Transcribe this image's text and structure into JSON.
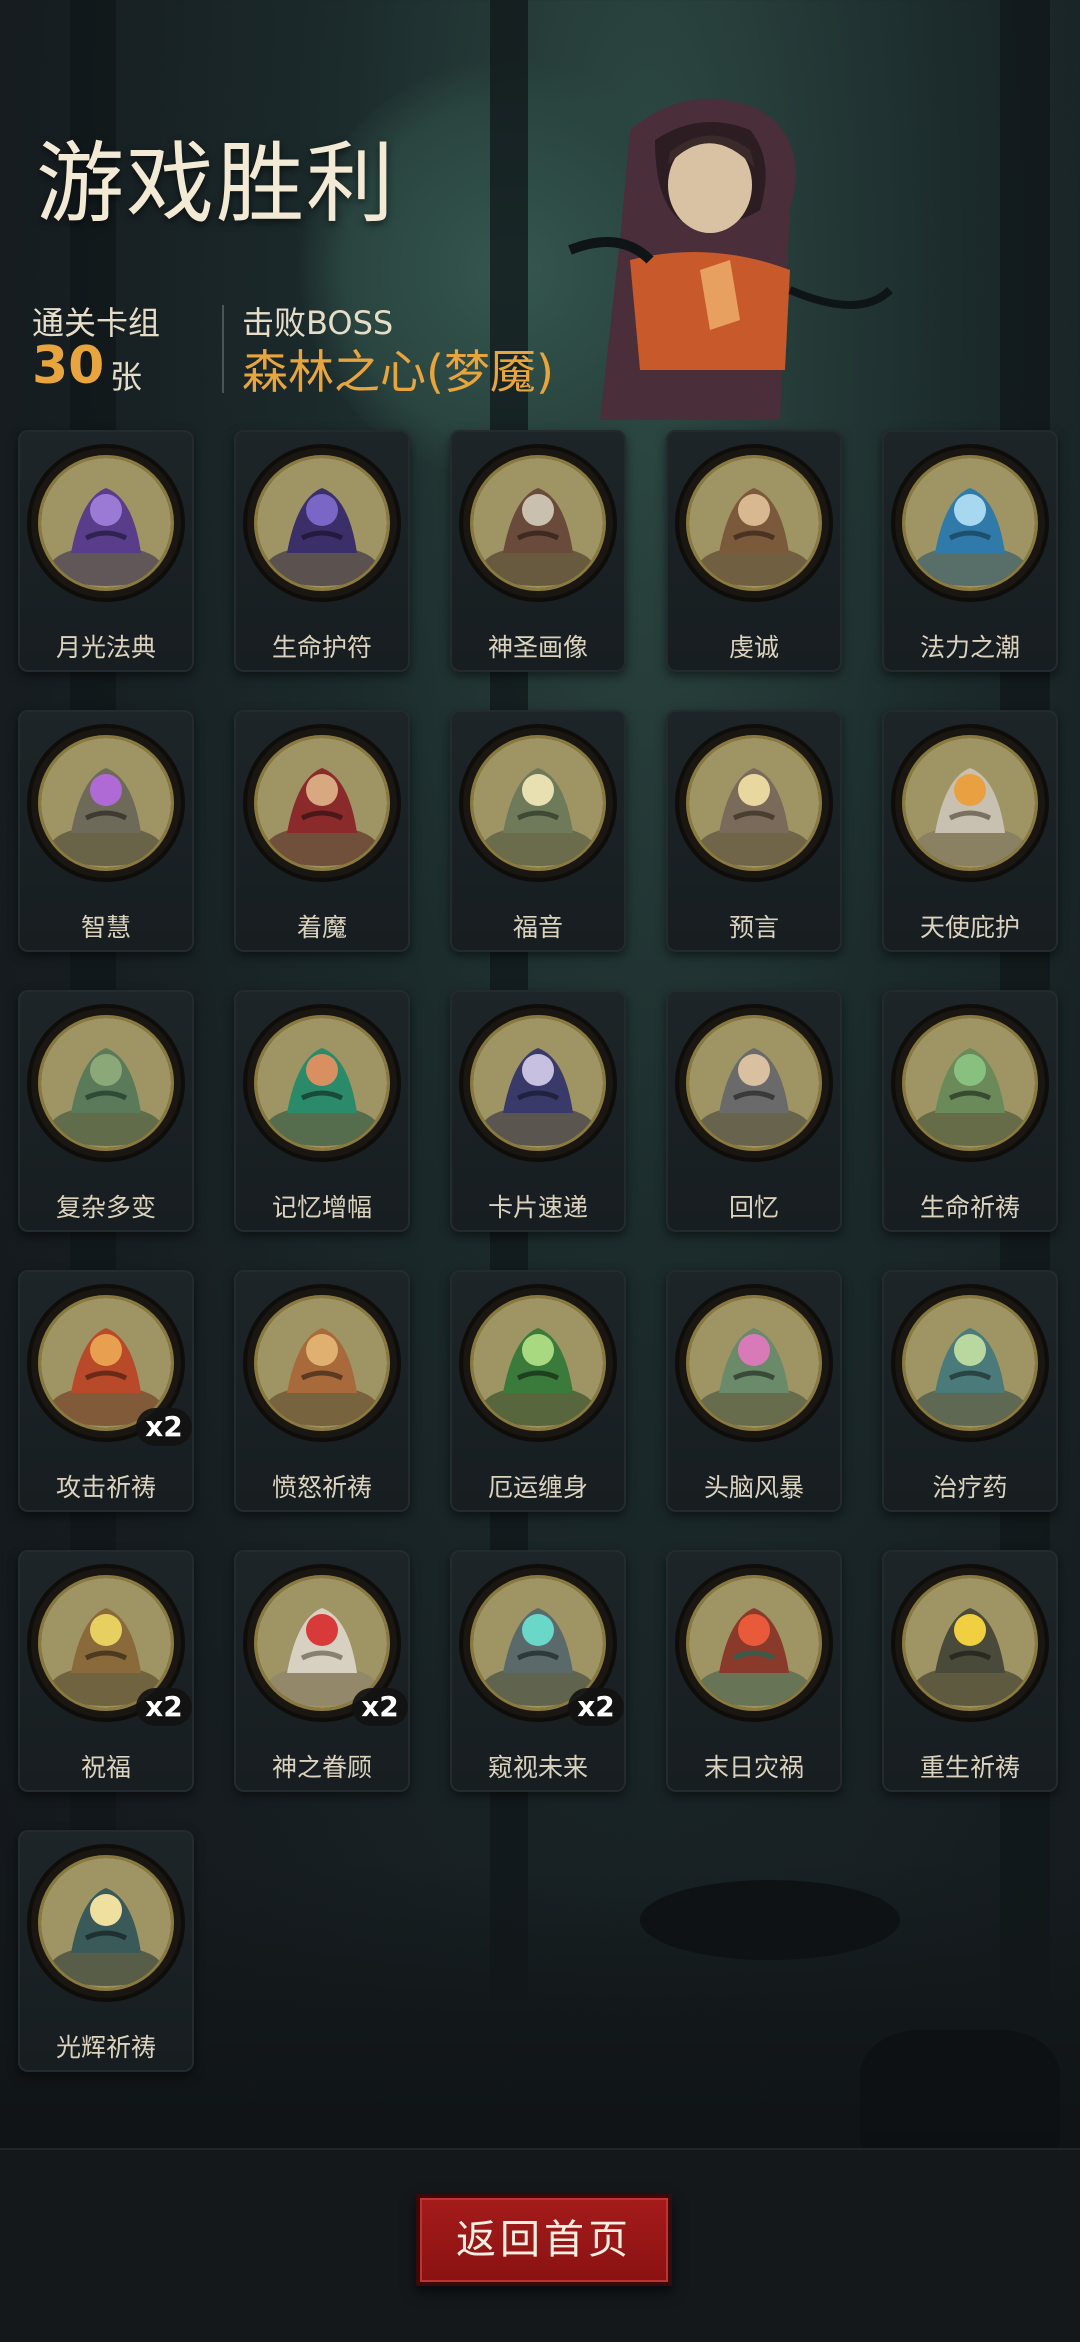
{
  "title": "游戏胜利",
  "stats": {
    "deck_label": "通关卡组",
    "deck_count": "30",
    "deck_unit": "张",
    "boss_label": "击败BOSS",
    "boss_name": "森林之心(梦魇)"
  },
  "colors": {
    "accent_gold": "#e8a53d",
    "button_red": "#a51b1b",
    "medallion_bg": "#9e9464"
  },
  "cards": [
    {
      "name": "月光法典",
      "icon": "tome-icon",
      "multiplier": ""
    },
    {
      "name": "生命护符",
      "icon": "bat-amulet-icon",
      "multiplier": ""
    },
    {
      "name": "神圣画像",
      "icon": "portrait-icon",
      "multiplier": ""
    },
    {
      "name": "虔诚",
      "icon": "praying-figure-icon",
      "multiplier": ""
    },
    {
      "name": "法力之潮",
      "icon": "wave-icon",
      "multiplier": ""
    },
    {
      "name": "智慧",
      "icon": "sage-icon",
      "multiplier": ""
    },
    {
      "name": "着魔",
      "icon": "possessed-icon",
      "multiplier": ""
    },
    {
      "name": "福音",
      "icon": "cross-icon",
      "multiplier": ""
    },
    {
      "name": "预言",
      "icon": "prophet-icon",
      "multiplier": ""
    },
    {
      "name": "天使庇护",
      "icon": "winged-crown-icon",
      "multiplier": ""
    },
    {
      "name": "复杂多变",
      "icon": "tangle-icon",
      "multiplier": ""
    },
    {
      "name": "记忆增幅",
      "icon": "brain-icon",
      "multiplier": ""
    },
    {
      "name": "卡片速递",
      "icon": "flying-card-icon",
      "multiplier": ""
    },
    {
      "name": "回忆",
      "icon": "old-man-icon",
      "multiplier": ""
    },
    {
      "name": "生命祈祷",
      "icon": "sprout-icon",
      "multiplier": ""
    },
    {
      "name": "攻击祈祷",
      "icon": "fist-icon",
      "multiplier": "x2"
    },
    {
      "name": "愤怒祈祷",
      "icon": "beast-icon",
      "multiplier": ""
    },
    {
      "name": "厄运缠身",
      "icon": "skull-icon",
      "multiplier": ""
    },
    {
      "name": "头脑风暴",
      "icon": "zombie-brain-icon",
      "multiplier": ""
    },
    {
      "name": "治疗药",
      "icon": "zombie-potion-icon",
      "multiplier": ""
    },
    {
      "name": "祝福",
      "icon": "knight-icon",
      "multiplier": "x2"
    },
    {
      "name": "神之眷顾",
      "icon": "angel-heart-icon",
      "multiplier": "x2"
    },
    {
      "name": "窥视未来",
      "icon": "spiral-mirror-icon",
      "multiplier": "x2"
    },
    {
      "name": "末日灾祸",
      "icon": "fire-field-icon",
      "multiplier": ""
    },
    {
      "name": "重生祈祷",
      "icon": "lightning-icon",
      "multiplier": ""
    },
    {
      "name": "光辉祈祷",
      "icon": "hooded-light-icon",
      "multiplier": ""
    }
  ],
  "return_button": "返回首页"
}
